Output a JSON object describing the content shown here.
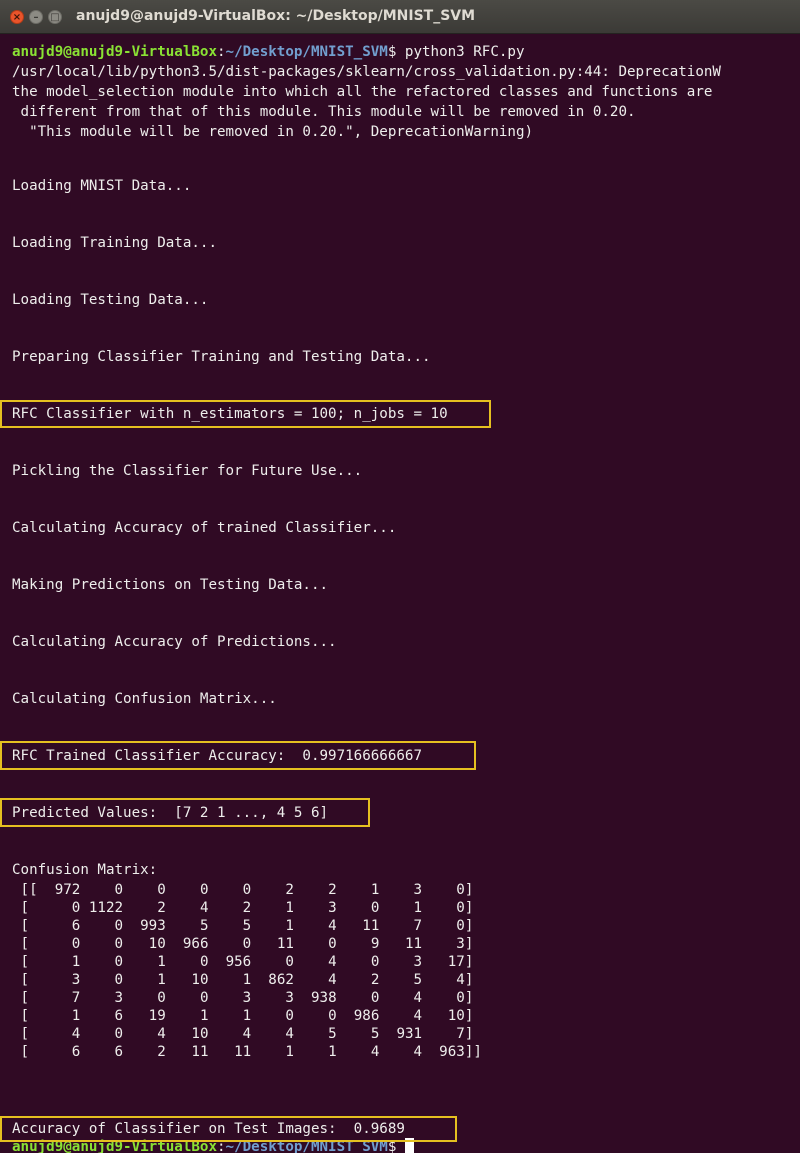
{
  "window": {
    "title": "anujd9@anujd9-VirtualBox: ~/Desktop/MNIST_SVM",
    "buttons": {
      "close": "×",
      "minimize": "–",
      "maximize": "□"
    }
  },
  "prompt": {
    "user_host": "anujd9@anujd9-VirtualBox",
    "separator": ":",
    "path": "~/Desktop/MNIST_SVM",
    "symbol": "$",
    "command": " python3 RFC.py"
  },
  "warning": [
    "/usr/local/lib/python3.5/dist-packages/sklearn/cross_validation.py:44: DeprecationW",
    "the model_selection module into which all the refactored classes and functions are",
    " different from that of this module. This module will be removed in 0.20.",
    "  \"This module will be removed in 0.20.\", DeprecationWarning)"
  ],
  "messages": {
    "loading_mnist": "Loading MNIST Data...",
    "loading_training": "Loading Training Data...",
    "loading_testing": "Loading Testing Data...",
    "preparing": "Preparing Classifier Training and Testing Data...",
    "rfc_params": "RFC Classifier with n_estimators = 100; n_jobs = 10",
    "pickling": "Pickling the Classifier for Future Use...",
    "calc_trained": "Calculating Accuracy of trained Classifier...",
    "making_predictions": "Making Predictions on Testing Data...",
    "calc_predictions": "Calculating Accuracy of Predictions...",
    "calc_confusion": "Calculating Confusion Matrix...",
    "trained_accuracy": "RFC Trained Classifier Accuracy:  0.997166666667",
    "predicted_values": "Predicted Values:  [7 2 1 ..., 4 5 6]",
    "confusion_header": "Confusion Matrix:",
    "test_accuracy": "Accuracy of Classifier on Test Images:  0.9689"
  },
  "confusion_matrix": [
    [
      972,
      0,
      0,
      0,
      0,
      2,
      2,
      1,
      3,
      0
    ],
    [
      0,
      1122,
      2,
      4,
      2,
      1,
      3,
      0,
      1,
      0
    ],
    [
      6,
      0,
      993,
      5,
      5,
      1,
      4,
      11,
      7,
      0
    ],
    [
      0,
      0,
      10,
      966,
      0,
      11,
      0,
      9,
      11,
      3
    ],
    [
      1,
      0,
      1,
      0,
      956,
      0,
      4,
      0,
      3,
      17
    ],
    [
      3,
      0,
      1,
      10,
      1,
      862,
      4,
      2,
      5,
      4
    ],
    [
      7,
      3,
      0,
      0,
      3,
      3,
      938,
      0,
      4,
      0
    ],
    [
      1,
      6,
      19,
      1,
      1,
      0,
      0,
      986,
      4,
      10
    ],
    [
      4,
      0,
      4,
      10,
      4,
      4,
      5,
      5,
      931,
      7
    ],
    [
      6,
      6,
      2,
      11,
      11,
      1,
      1,
      4,
      4,
      963
    ]
  ],
  "colors": {
    "background": "#300a24",
    "text": "#eeeeec",
    "prompt_user": "#8ae234",
    "prompt_path": "#729fcf",
    "highlight_box": "#e5c020"
  }
}
